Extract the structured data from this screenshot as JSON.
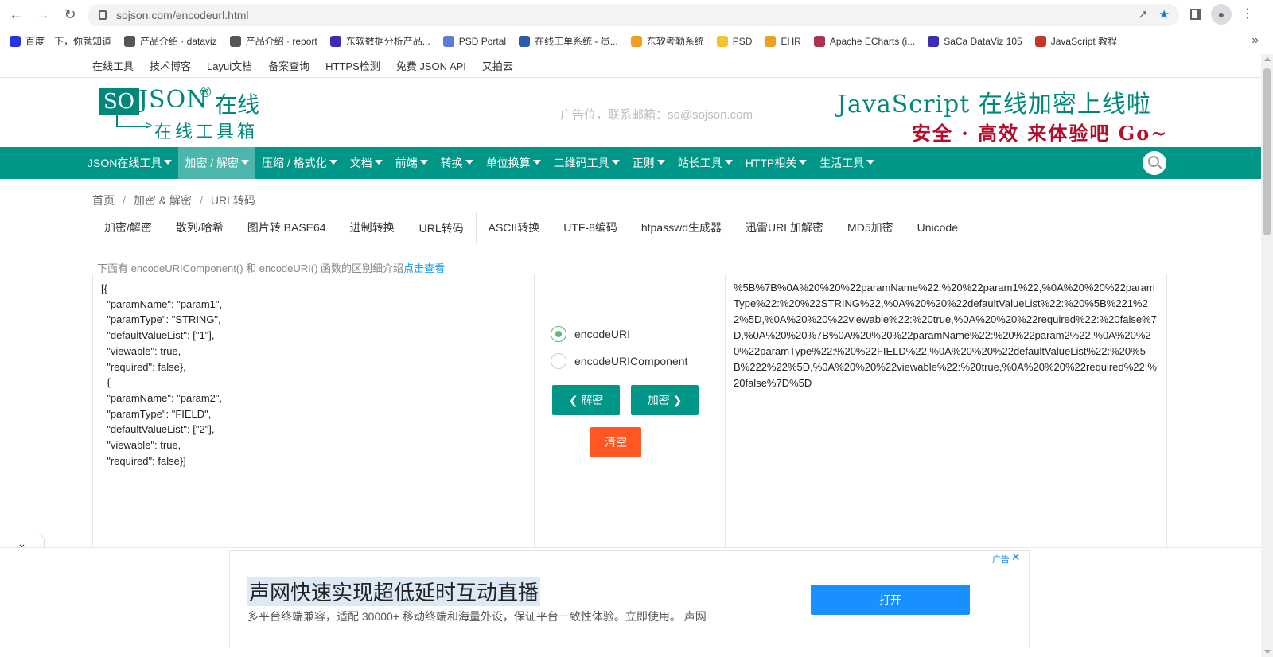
{
  "browser": {
    "url_host": "sojson.com",
    "url_path": "/encodeurl.html",
    "bookmarks": [
      {
        "label": "百度一下，你就知道",
        "color": "#2932e1"
      },
      {
        "label": "产品介绍 · dataviz",
        "color": "#555555"
      },
      {
        "label": "产品介绍 · report",
        "color": "#555555"
      },
      {
        "label": "东软数据分析产品...",
        "color": "#3b2bb5"
      },
      {
        "label": "PSD Portal",
        "color": "#5b7bd5"
      },
      {
        "label": "在线工单系统 - 员...",
        "color": "#2a5caa"
      },
      {
        "label": "东软考勤系统",
        "color": "#f0a020"
      },
      {
        "label": "PSD",
        "color": "#f4c430"
      },
      {
        "label": "EHR",
        "color": "#f0a020"
      },
      {
        "label": "Apache ECharts (i...",
        "color": "#aa344d"
      },
      {
        "label": "SaCa DataViz 105",
        "color": "#3b2bb5"
      },
      {
        "label": "JavaScript 教程",
        "color": "#c0392b"
      }
    ]
  },
  "top_links": [
    "在线工具",
    "技术博客",
    "Layui文档",
    "备案查询",
    "HTTPS检测",
    "免费 JSON API",
    "又拍云"
  ],
  "header": {
    "logo_so": "SO",
    "logo_json": "JSON",
    "logo_reg": "®",
    "logo_zx": "在线",
    "logo_arrow": ">",
    "logo_tool": "在线工具箱",
    "ad_text": "广告位，联系邮箱：so@sojson.com",
    "promo_line1": "JavaScript 在线加密上线啦",
    "promo_line2": "安全 · 高效  来体验吧 Go~"
  },
  "main_nav": [
    {
      "label": "JSON在线工具",
      "active": false
    },
    {
      "label": "加密 / 解密",
      "active": true
    },
    {
      "label": "压缩 / 格式化",
      "active": false
    },
    {
      "label": "文档",
      "active": false
    },
    {
      "label": "前端",
      "active": false
    },
    {
      "label": "转换",
      "active": false
    },
    {
      "label": "单位换算",
      "active": false
    },
    {
      "label": "二维码工具",
      "active": false
    },
    {
      "label": "正则",
      "active": false
    },
    {
      "label": "站长工具",
      "active": false
    },
    {
      "label": "HTTP相关",
      "active": false
    },
    {
      "label": "生活工具",
      "active": false
    }
  ],
  "breadcrumb": [
    "首页",
    "加密 & 解密",
    "URL转码"
  ],
  "tabs": [
    {
      "label": "加密/解密",
      "active": false
    },
    {
      "label": "散列/哈希",
      "active": false
    },
    {
      "label": "图片转 BASE64",
      "active": false
    },
    {
      "label": "进制转换",
      "active": false
    },
    {
      "label": "URL转码",
      "active": true
    },
    {
      "label": "ASCII转换",
      "active": false
    },
    {
      "label": "UTF-8编码",
      "active": false
    },
    {
      "label": "htpasswd生成器",
      "active": false
    },
    {
      "label": "迅雷URL加解密",
      "active": false
    },
    {
      "label": "MD5加密",
      "active": false
    },
    {
      "label": "Unicode",
      "active": false
    }
  ],
  "hint": {
    "text": "下面有 encodeURIComponent() 和 encodeURI() 函数的区别细介绍",
    "link": "点击查看"
  },
  "input_text": "[{\n  \"paramName\": \"param1\",\n  \"paramType\": \"STRING\",\n  \"defaultValueList\": [\"1\"],\n  \"viewable\": true,\n  \"required\": false},\n  {\n  \"paramName\": \"param2\",\n  \"paramType\": \"FIELD\",\n  \"defaultValueList\": [\"2\"],\n  \"viewable\": true,\n  \"required\": false}]",
  "output_text": "%5B%7B%0A%20%20%22paramName%22:%20%22param1%22,%0A%20%20%22paramType%22:%20%22STRING%22,%0A%20%20%22defaultValueList%22:%20%5B%221%22%5D,%0A%20%20%22viewable%22:%20true,%0A%20%20%22required%22:%20false%7D,%0A%20%20%7B%0A%20%20%22paramName%22:%20%22param2%22,%0A%20%20%22paramType%22:%20%22FIELD%22,%0A%20%20%22defaultValueList%22:%20%5B%222%22%5D,%0A%20%20%22viewable%22:%20true,%0A%20%20%22required%22:%20false%7D%5D",
  "options": {
    "encodeURI": "encodeURI",
    "encodeURIComponent": "encodeURIComponent",
    "selected": "encodeURI"
  },
  "buttons": {
    "decode": "解密",
    "encode": "加密",
    "clear": "清空"
  },
  "ad": {
    "title": "声网快速实现超低延时互动直播",
    "desc": "多平台终端兼容，适配 30000+ 移动终端和海量外设，保证平台一致性体验。立即使用。 声网",
    "button": "打开",
    "tag": "广告"
  },
  "colors": {
    "primary": "#009688",
    "nav_active": "#4db6ac",
    "danger": "#ff5722",
    "ad_button": "#1890ff"
  }
}
